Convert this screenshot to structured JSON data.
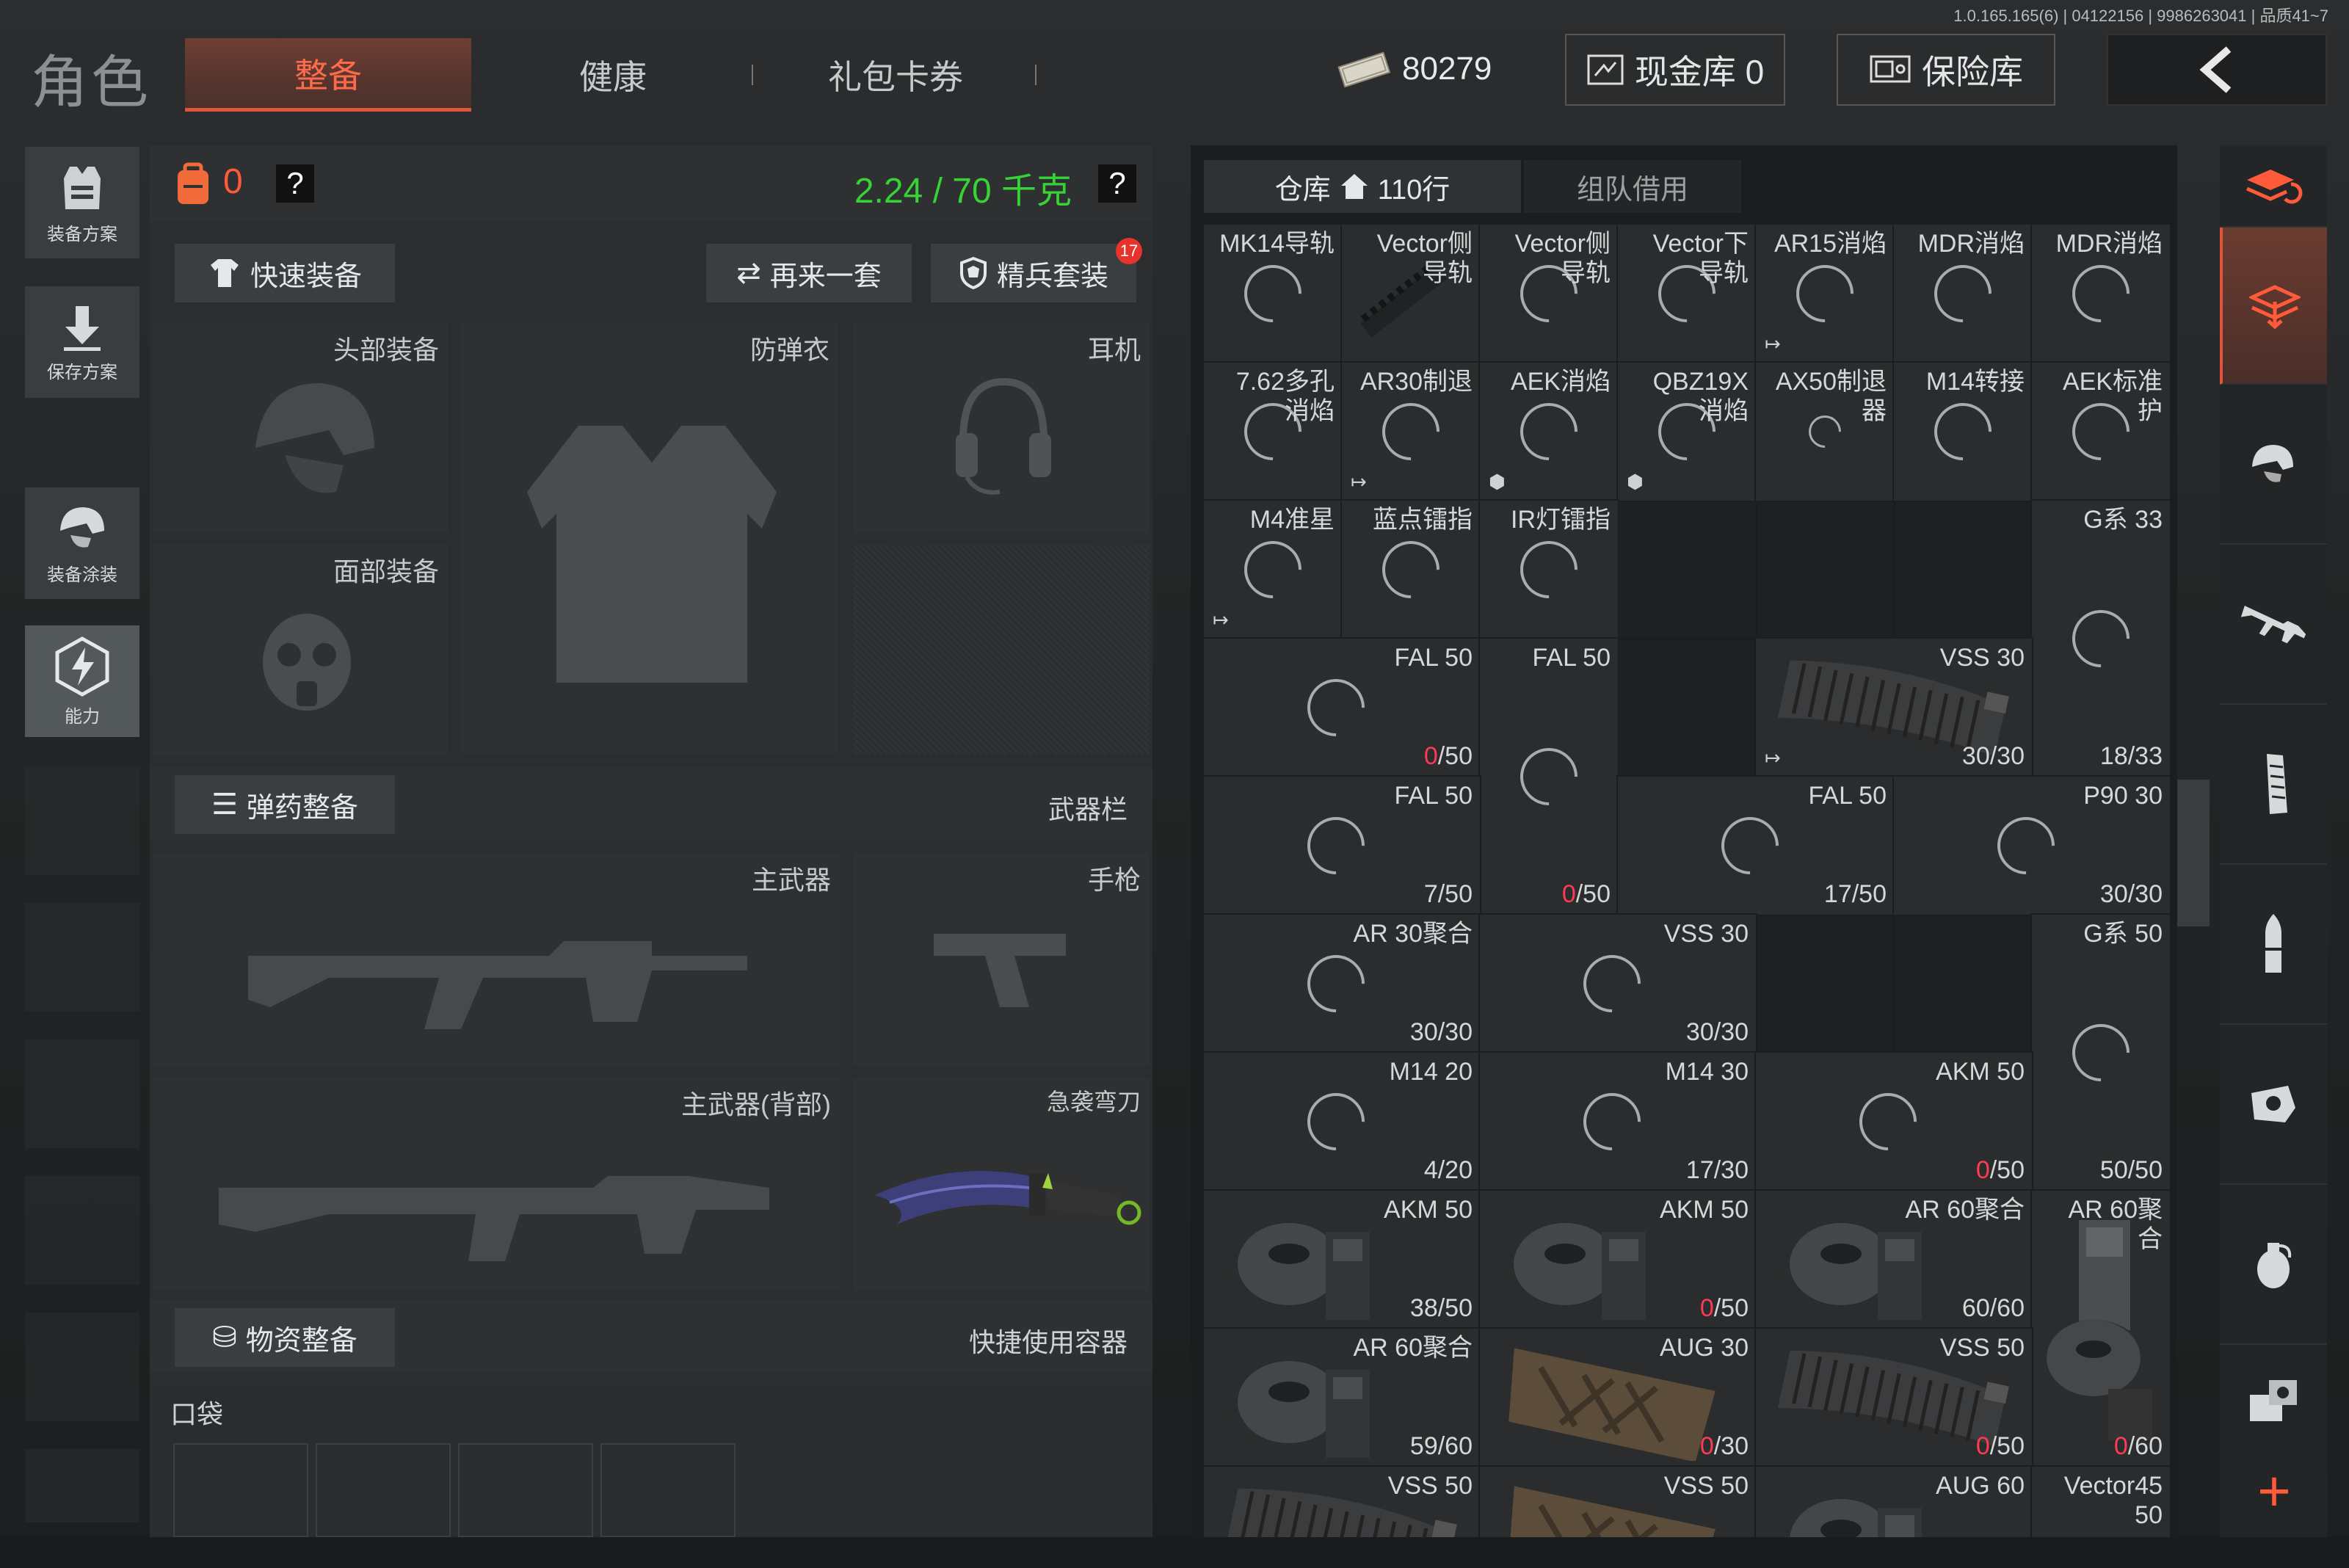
{
  "version": "1.0.165.165(6) | 04122156 | 9986263041 | 品质41~7",
  "title": "角色",
  "tabs": {
    "equip": "整备",
    "health": "健康",
    "gift": "礼包卡券"
  },
  "cash": "80279",
  "top_buttons": {
    "cash_vault": "现金库 0",
    "safe": "保险库"
  },
  "sidebar": {
    "plan": "装备方案",
    "save": "保存方案",
    "skin": "装备涂装",
    "ability": "能力"
  },
  "loadout": {
    "count": "0",
    "help": "?",
    "weight": "2.24 / 70 千克",
    "quick_equip": "快速装备",
    "again": "再来一套",
    "elite": "精兵套装",
    "elite_badge": "17",
    "slots": {
      "head": "头部装备",
      "armor": "防弹衣",
      "headset": "耳机",
      "face": "面部装备"
    },
    "ammo_header": "弹药整备",
    "weapon_bar": "武器栏",
    "weapon_slots": {
      "primary": "主武器",
      "pistol": "手枪",
      "primary_back": "主武器(背部)",
      "melee": "急袭弯刀"
    },
    "supply_header": "物资整备",
    "quick_container": "快捷使用容器",
    "pocket": "口袋"
  },
  "warehouse": {
    "tab": "仓库",
    "rows": "110行",
    "team": "组队借用"
  },
  "colors": {
    "accent": "#e0553a",
    "weight_green": "#36d236",
    "count_red": "#ff3a55"
  },
  "grid": [
    {
      "r": 0,
      "c": 0,
      "w": 1,
      "h": 1,
      "name": "MK14导轨",
      "ring": true
    },
    {
      "r": 0,
      "c": 1,
      "w": 1,
      "h": 1,
      "name": "Vector侧\n导轨",
      "img": "rail"
    },
    {
      "r": 0,
      "c": 2,
      "w": 1,
      "h": 1,
      "name": "Vector侧\n导轨",
      "ring": true
    },
    {
      "r": 0,
      "c": 3,
      "w": 1,
      "h": 1,
      "name": "Vector下\n导轨",
      "ring": true
    },
    {
      "r": 0,
      "c": 4,
      "w": 1,
      "h": 1,
      "name": "AR15消焰",
      "ring": true,
      "mark": "↦"
    },
    {
      "r": 0,
      "c": 5,
      "w": 1,
      "h": 1,
      "name": "MDR消焰",
      "ring": true
    },
    {
      "r": 0,
      "c": 6,
      "w": 1,
      "h": 1,
      "name": "MDR消焰",
      "ring": true
    },
    {
      "r": 1,
      "c": 0,
      "w": 1,
      "h": 1,
      "name": "7.62多孔\n消焰",
      "ring": true
    },
    {
      "r": 1,
      "c": 1,
      "w": 1,
      "h": 1,
      "name": "AR30制退",
      "ring": true,
      "mark": "↦"
    },
    {
      "r": 1,
      "c": 2,
      "w": 1,
      "h": 1,
      "name": "AEK消焰",
      "ring": true,
      "mark": "⬢"
    },
    {
      "r": 1,
      "c": 3,
      "w": 1,
      "h": 1,
      "name": "QBZ19X\n消焰",
      "ring": true,
      "mark": "⬢"
    },
    {
      "r": 1,
      "c": 4,
      "w": 1,
      "h": 1,
      "name": "AX50制退\n器",
      "ring": "sm"
    },
    {
      "r": 1,
      "c": 5,
      "w": 1,
      "h": 1,
      "name": "M14转接",
      "ring": true
    },
    {
      "r": 1,
      "c": 6,
      "w": 1,
      "h": 1,
      "name": "AEK标准\n护",
      "ring": true
    },
    {
      "r": 2,
      "c": 0,
      "w": 1,
      "h": 1,
      "name": "M4准星",
      "ring": true,
      "mark": "↦"
    },
    {
      "r": 2,
      "c": 1,
      "w": 1,
      "h": 1,
      "name": "蓝点镭指",
      "ring": true
    },
    {
      "r": 2,
      "c": 2,
      "w": 1,
      "h": 1,
      "name": "IR灯镭指",
      "ring": true
    },
    {
      "r": 2,
      "c": 6,
      "w": 1,
      "h": 2,
      "name": "G系 33",
      "ring": true,
      "count": "18/33"
    },
    {
      "r": 3,
      "c": 0,
      "w": 2,
      "h": 1,
      "name": "FAL 50",
      "ring": true,
      "count": [
        {
          "t": "0",
          "red": true
        },
        {
          "t": "/50"
        }
      ]
    },
    {
      "r": 3,
      "c": 2,
      "w": 1,
      "h": 2,
      "name": "FAL 50",
      "ring": true,
      "count": [
        {
          "t": "0",
          "red": true
        },
        {
          "t": "/50"
        }
      ]
    },
    {
      "r": 3,
      "c": 4,
      "w": 2,
      "h": 1,
      "name": "VSS 30",
      "img": "mag",
      "count": "30/30",
      "mark": "↦"
    },
    {
      "r": 4,
      "c": 0,
      "w": 2,
      "h": 1,
      "name": "FAL 50",
      "ring": true,
      "count": "7/50"
    },
    {
      "r": 4,
      "c": 3,
      "w": 2,
      "h": 1,
      "name": "FAL 50",
      "ring": true,
      "count": "17/50"
    },
    {
      "r": 4,
      "c": 5,
      "w": 2,
      "h": 1,
      "name": "P90 30",
      "ring": true,
      "count": "30/30"
    },
    {
      "r": 5,
      "c": 0,
      "w": 2,
      "h": 1,
      "name": "AR 30聚合",
      "ring": true,
      "count": "30/30"
    },
    {
      "r": 5,
      "c": 2,
      "w": 2,
      "h": 1,
      "name": "VSS 30",
      "ring": true,
      "count": "30/30"
    },
    {
      "r": 5,
      "c": 6,
      "w": 1,
      "h": 2,
      "name": "G系 50",
      "ring": true,
      "count": "50/50"
    },
    {
      "r": 6,
      "c": 0,
      "w": 2,
      "h": 1,
      "name": "M14 20",
      "ring": true,
      "count": "4/20"
    },
    {
      "r": 6,
      "c": 2,
      "w": 2,
      "h": 1,
      "name": "M14 30",
      "ring": true,
      "count": "17/30"
    },
    {
      "r": 6,
      "c": 4,
      "w": 2,
      "h": 1,
      "name": "AKM 50",
      "ring": true,
      "count": [
        {
          "t": "0",
          "red": true
        },
        {
          "t": "/50"
        }
      ]
    },
    {
      "r": 7,
      "c": 0,
      "w": 2,
      "h": 1,
      "name": "AKM 50",
      "img": "drum",
      "count": "38/50"
    },
    {
      "r": 7,
      "c": 2,
      "w": 2,
      "h": 1,
      "name": "AKM 50",
      "img": "drum",
      "count": [
        {
          "t": "0",
          "red": true
        },
        {
          "t": "/50"
        }
      ]
    },
    {
      "r": 7,
      "c": 4,
      "w": 2,
      "h": 1,
      "name": "AR 60聚合",
      "img": "drum",
      "count": "60/60"
    },
    {
      "r": 7,
      "c": 6,
      "w": 1,
      "h": 2,
      "name": "AR 60聚\n合",
      "img": "drumtall",
      "count": [
        {
          "t": "0",
          "red": true
        },
        {
          "t": "/60"
        }
      ]
    },
    {
      "r": 8,
      "c": 0,
      "w": 2,
      "h": 1,
      "name": "AR 60聚合",
      "img": "drum",
      "count": "59/60"
    },
    {
      "r": 8,
      "c": 2,
      "w": 2,
      "h": 1,
      "name": "AUG 30",
      "img": "aug",
      "count": [
        {
          "t": "0",
          "red": true
        },
        {
          "t": "/30"
        }
      ]
    },
    {
      "r": 8,
      "c": 4,
      "w": 2,
      "h": 1,
      "name": "VSS 50",
      "img": "mag",
      "count": [
        {
          "t": "0",
          "red": true
        },
        {
          "t": "/50"
        }
      ]
    },
    {
      "r": 9,
      "c": 0,
      "w": 2,
      "h": 1,
      "name": "VSS 50",
      "img": "mag"
    },
    {
      "r": 9,
      "c": 2,
      "w": 2,
      "h": 1,
      "name": "VSS 50",
      "img": "aug"
    },
    {
      "r": 9,
      "c": 4,
      "w": 2,
      "h": 1,
      "name": "AUG 60",
      "img": "drum"
    },
    {
      "r": 9,
      "c": 6,
      "w": 1,
      "h": 1,
      "name": "Vector45\n50"
    }
  ]
}
